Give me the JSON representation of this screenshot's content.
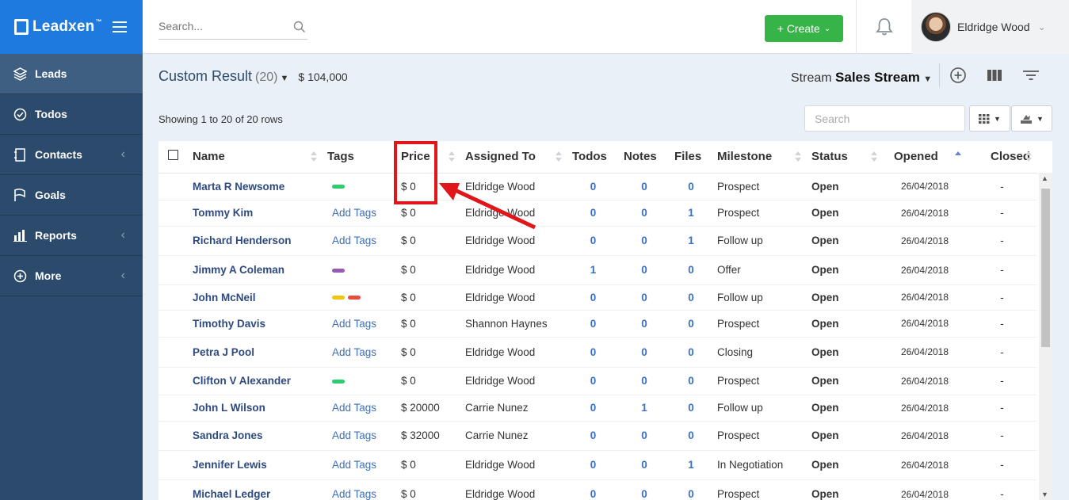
{
  "brand": {
    "name": "Leadxen",
    "tm": "™"
  },
  "nav": [
    {
      "label": "Leads",
      "icon": "layers-icon",
      "active": true,
      "chevron": false
    },
    {
      "label": "Todos",
      "icon": "check-circle-icon",
      "active": false,
      "chevron": false
    },
    {
      "label": "Contacts",
      "icon": "address-book-icon",
      "active": false,
      "chevron": true
    },
    {
      "label": "Goals",
      "icon": "flag-icon",
      "active": false,
      "chevron": false
    },
    {
      "label": "Reports",
      "icon": "bar-chart-icon",
      "active": false,
      "chevron": true
    },
    {
      "label": "More",
      "icon": "plus-circle-icon",
      "active": false,
      "chevron": true
    }
  ],
  "topbar": {
    "search_placeholder": "Search...",
    "create_label": "+ Create",
    "user_name": "Eldridge Wood"
  },
  "header": {
    "title": "Custom Result",
    "count": "(20)",
    "total": "$ 104,000",
    "stream_label": "Stream",
    "stream_name": "Sales Stream"
  },
  "table": {
    "showing": "Showing 1 to 20 of 20 rows",
    "search_placeholder": "Search",
    "columns": [
      "Name",
      "Tags",
      "Price",
      "Assigned To",
      "Todos",
      "Notes",
      "Files",
      "Milestone",
      "Status",
      "Opened",
      "Closed"
    ],
    "add_tags_label": "Add Tags",
    "rows": [
      {
        "name": "Marta R Newsome",
        "tags": [
          "#2ecc71"
        ],
        "price": "$ 0",
        "assigned": "Eldridge Wood",
        "todos": "0",
        "notes": "0",
        "files": "0",
        "milestone": "Prospect",
        "status": "Open",
        "opened": "26/04/2018",
        "closed": "-"
      },
      {
        "name": "Tommy Kim",
        "tags": [],
        "price": "$ 0",
        "assigned": "Eldridge Wood",
        "todos": "0",
        "notes": "0",
        "files": "1",
        "milestone": "Prospect",
        "status": "Open",
        "opened": "26/04/2018",
        "closed": "-"
      },
      {
        "name": "Richard Henderson",
        "tags": [],
        "price": "$ 0",
        "assigned": "Eldridge Wood",
        "todos": "0",
        "notes": "0",
        "files": "1",
        "milestone": "Follow up",
        "status": "Open",
        "opened": "26/04/2018",
        "closed": "-"
      },
      {
        "name": "Jimmy A Coleman",
        "tags": [
          "#9b59b6"
        ],
        "price": "$ 0",
        "assigned": "Eldridge Wood",
        "todos": "1",
        "notes": "0",
        "files": "0",
        "milestone": "Offer",
        "status": "Open",
        "opened": "26/04/2018",
        "closed": "-"
      },
      {
        "name": "John McNeil",
        "tags": [
          "#f1c40f",
          "#e74c3c"
        ],
        "price": "$ 0",
        "assigned": "Eldridge Wood",
        "todos": "0",
        "notes": "0",
        "files": "0",
        "milestone": "Follow up",
        "status": "Open",
        "opened": "26/04/2018",
        "closed": "-"
      },
      {
        "name": "Timothy Davis",
        "tags": [],
        "price": "$ 0",
        "assigned": "Shannon Haynes",
        "todos": "0",
        "notes": "0",
        "files": "0",
        "milestone": "Prospect",
        "status": "Open",
        "opened": "26/04/2018",
        "closed": "-"
      },
      {
        "name": "Petra J Pool",
        "tags": [],
        "price": "$ 0",
        "assigned": "Eldridge Wood",
        "todos": "0",
        "notes": "0",
        "files": "0",
        "milestone": "Closing",
        "status": "Open",
        "opened": "26/04/2018",
        "closed": "-"
      },
      {
        "name": "Clifton V Alexander",
        "tags": [
          "#2ecc71"
        ],
        "price": "$ 0",
        "assigned": "Eldridge Wood",
        "todos": "0",
        "notes": "0",
        "files": "0",
        "milestone": "Prospect",
        "status": "Open",
        "opened": "26/04/2018",
        "closed": "-"
      },
      {
        "name": "John L Wilson",
        "tags": [],
        "price": "$ 20000",
        "assigned": "Carrie Nunez",
        "todos": "0",
        "notes": "1",
        "files": "0",
        "milestone": "Follow up",
        "status": "Open",
        "opened": "26/04/2018",
        "closed": "-"
      },
      {
        "name": "Sandra Jones",
        "tags": [],
        "price": "$ 32000",
        "assigned": "Carrie Nunez",
        "todos": "0",
        "notes": "0",
        "files": "0",
        "milestone": "Prospect",
        "status": "Open",
        "opened": "26/04/2018",
        "closed": "-"
      },
      {
        "name": "Jennifer Lewis",
        "tags": [],
        "price": "$ 0",
        "assigned": "Eldridge Wood",
        "todos": "0",
        "notes": "0",
        "files": "1",
        "milestone": "In Negotiation",
        "status": "Open",
        "opened": "26/04/2018",
        "closed": "-"
      },
      {
        "name": "Michael Ledger",
        "tags": [],
        "price": "$ 0",
        "assigned": "Eldridge Wood",
        "todos": "0",
        "notes": "0",
        "files": "0",
        "milestone": "Prospect",
        "status": "Open",
        "opened": "26/04/2018",
        "closed": "-"
      }
    ]
  },
  "colors": {
    "brand_blue": "#1f7ae0",
    "sidebar": "#2c4a6b",
    "create_green": "#36b448",
    "annotation_red": "#e0161a"
  }
}
